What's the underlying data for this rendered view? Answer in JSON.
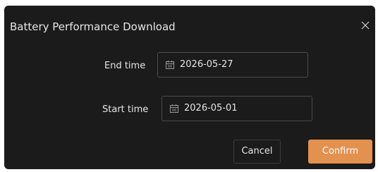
{
  "dialog": {
    "title": "Battery Performance Download",
    "close_icon": "close-icon"
  },
  "fields": {
    "end_time": {
      "label": "End time",
      "value": "2026-05-27",
      "icon": "calendar-icon"
    },
    "start_time": {
      "label": "Start time",
      "value": "2026-05-01",
      "icon": "calendar-icon"
    }
  },
  "buttons": {
    "cancel_label": "Cancel",
    "confirm_label": "Confirm"
  },
  "colors": {
    "dialog_background": "#1b1b1b",
    "accent": "#e3914f",
    "field_border": "#4a4a4a",
    "text": "#e6e6e6"
  }
}
